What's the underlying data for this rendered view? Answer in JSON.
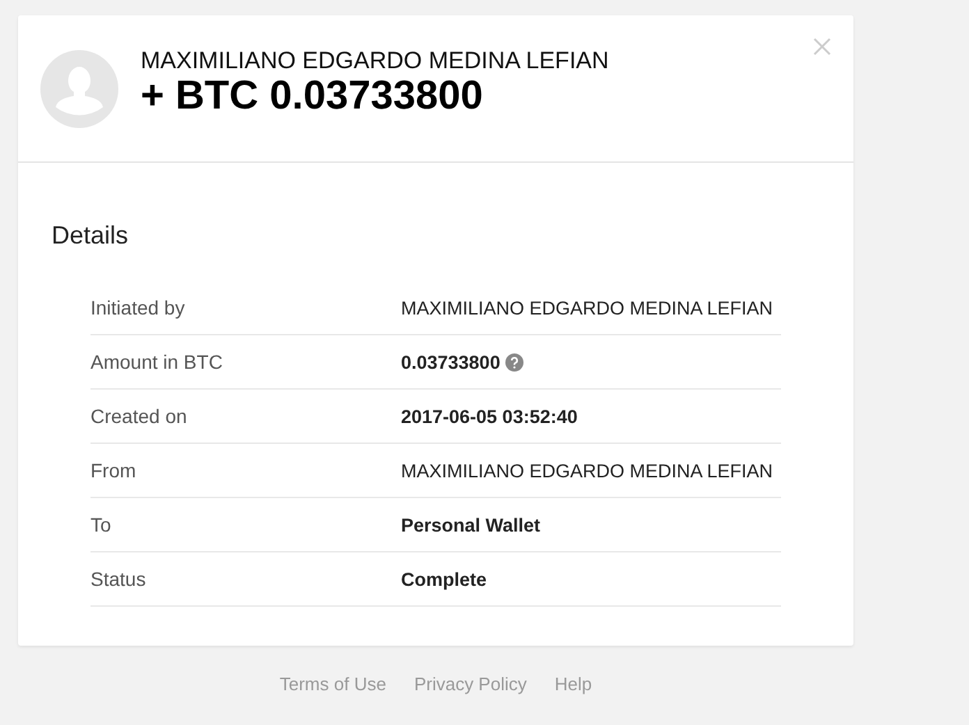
{
  "header": {
    "name": "MAXIMILIANO EDGARDO MEDINA LEFIAN",
    "amount": "+ BTC 0.03733800"
  },
  "details": {
    "title": "Details",
    "rows": [
      {
        "label": "Initiated by",
        "value": "MAXIMILIANO EDGARDO MEDINA LEFIAN",
        "kind": "name"
      },
      {
        "label": "Amount in BTC",
        "value": "0.03733800",
        "kind": "amount"
      },
      {
        "label": "Created on",
        "value": "2017-06-05 03:52:40",
        "kind": "plain"
      },
      {
        "label": "From",
        "value": "MAXIMILIANO EDGARDO MEDINA LEFIAN",
        "kind": "name"
      },
      {
        "label": "To",
        "value": "Personal Wallet",
        "kind": "plain"
      },
      {
        "label": "Status",
        "value": "Complete",
        "kind": "plain"
      }
    ]
  },
  "footer_links": [
    "Terms of Use",
    "Privacy Policy",
    "Help"
  ]
}
